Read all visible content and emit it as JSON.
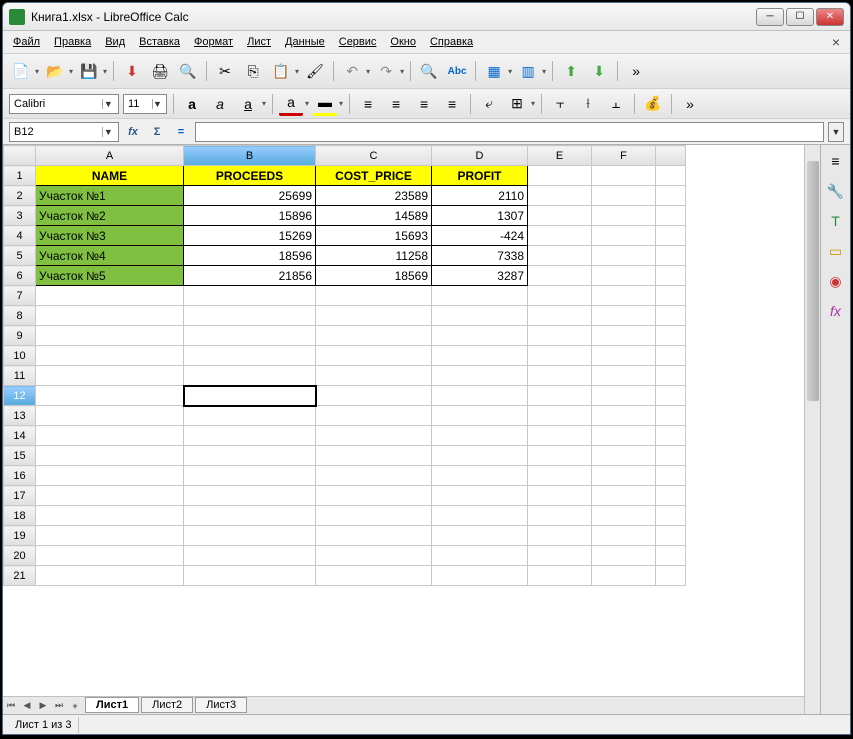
{
  "window": {
    "title": "Книга1.xlsx - LibreOffice Calc"
  },
  "menu": [
    "Файл",
    "Правка",
    "Вид",
    "Вставка",
    "Формат",
    "Лист",
    "Данные",
    "Сервис",
    "Окно",
    "Справка"
  ],
  "font": {
    "name": "Calibri",
    "size": "11"
  },
  "namebox": "B12",
  "formula": "",
  "columns": [
    "A",
    "B",
    "C",
    "D",
    "E",
    "F"
  ],
  "selected_col": "B",
  "selected_row": 12,
  "headers": {
    "A": "NAME",
    "B": "PROCEEDS",
    "C": "COST_PRICE",
    "D": "PROFIT"
  },
  "rows": [
    {
      "name": "Участок №1",
      "proceeds": "25699",
      "cost": "23589",
      "profit": "2110"
    },
    {
      "name": "Участок №2",
      "proceeds": "15896",
      "cost": "14589",
      "profit": "1307"
    },
    {
      "name": "Участок №3",
      "proceeds": "15269",
      "cost": "15693",
      "profit": "-424"
    },
    {
      "name": "Участок №4",
      "proceeds": "18596",
      "cost": "11258",
      "profit": "7338"
    },
    {
      "name": "Участок №5",
      "proceeds": "21856",
      "cost": "18569",
      "profit": "3287"
    }
  ],
  "sheets": [
    "Лист1",
    "Лист2",
    "Лист3"
  ],
  "active_sheet": 0,
  "status": "Лист 1 из 3",
  "chart_data": {
    "type": "table",
    "columns": [
      "NAME",
      "PROCEEDS",
      "COST_PRICE",
      "PROFIT"
    ],
    "data": [
      [
        "Участок №1",
        25699,
        23589,
        2110
      ],
      [
        "Участок №2",
        15896,
        14589,
        1307
      ],
      [
        "Участок №3",
        15269,
        15693,
        -424
      ],
      [
        "Участок №4",
        18596,
        11258,
        7338
      ],
      [
        "Участок №5",
        21856,
        18569,
        3287
      ]
    ]
  }
}
